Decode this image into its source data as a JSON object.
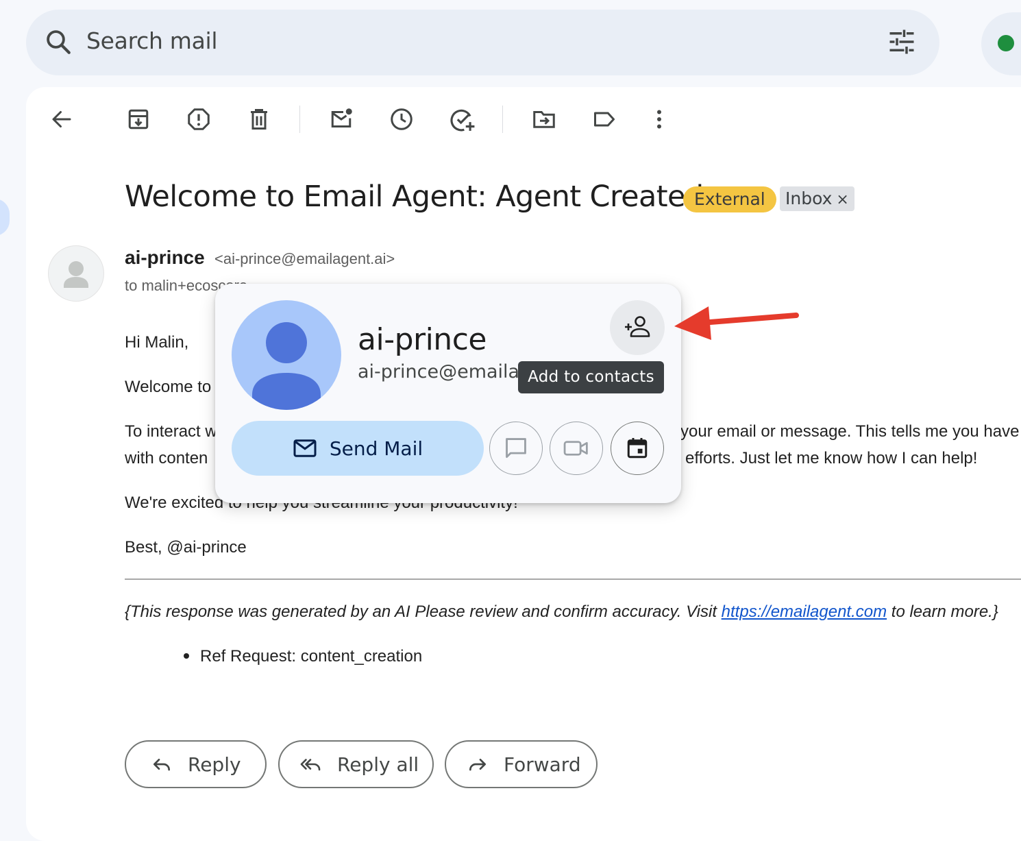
{
  "search": {
    "placeholder": "Search mail"
  },
  "email": {
    "subject": "Welcome to Email Agent: Agent Created",
    "labels": {
      "external": "External",
      "inbox": "Inbox",
      "inbox_remove": "×"
    },
    "sender": {
      "name": "ai-prince",
      "email": "<ai-prince@emailagent.ai>",
      "to": "to malin+ecoscore"
    },
    "body": {
      "greeting": "Hi Malin,",
      "line1_visible": "Welcome to",
      "para2_left_a": "To interact w",
      "para2_left_b": "with conten",
      "para2_right_a": "your email or message. This tells me you have",
      "para2_right_b": "efforts. Just let me know how I can help!",
      "para3": "We're excited to help you streamline your productivity!",
      "signoff": "Best, @ai-prince"
    },
    "footer": {
      "note_before": "{This response was generated by an AI Please review and confirm accuracy. Visit ",
      "link": "https://emailagent.com",
      "note_after": " to learn more.}",
      "ref_item": "Ref Request: content_creation"
    },
    "actions": {
      "reply": "Reply",
      "reply_all": "Reply all",
      "forward": "Forward"
    }
  },
  "hovercard": {
    "name": "ai-prince",
    "email": "ai-prince@emailagent.ai",
    "tooltip": "Add to contacts",
    "send_mail": "Send Mail"
  },
  "colors": {
    "external_chip": "#f4c542",
    "arrow": "#e53b2c",
    "send_mail_bg": "#c2e0fb",
    "avatar_bg": "#a8c7fa",
    "avatar_fg": "#4f74d9",
    "status_dot": "#1e8e3e"
  }
}
